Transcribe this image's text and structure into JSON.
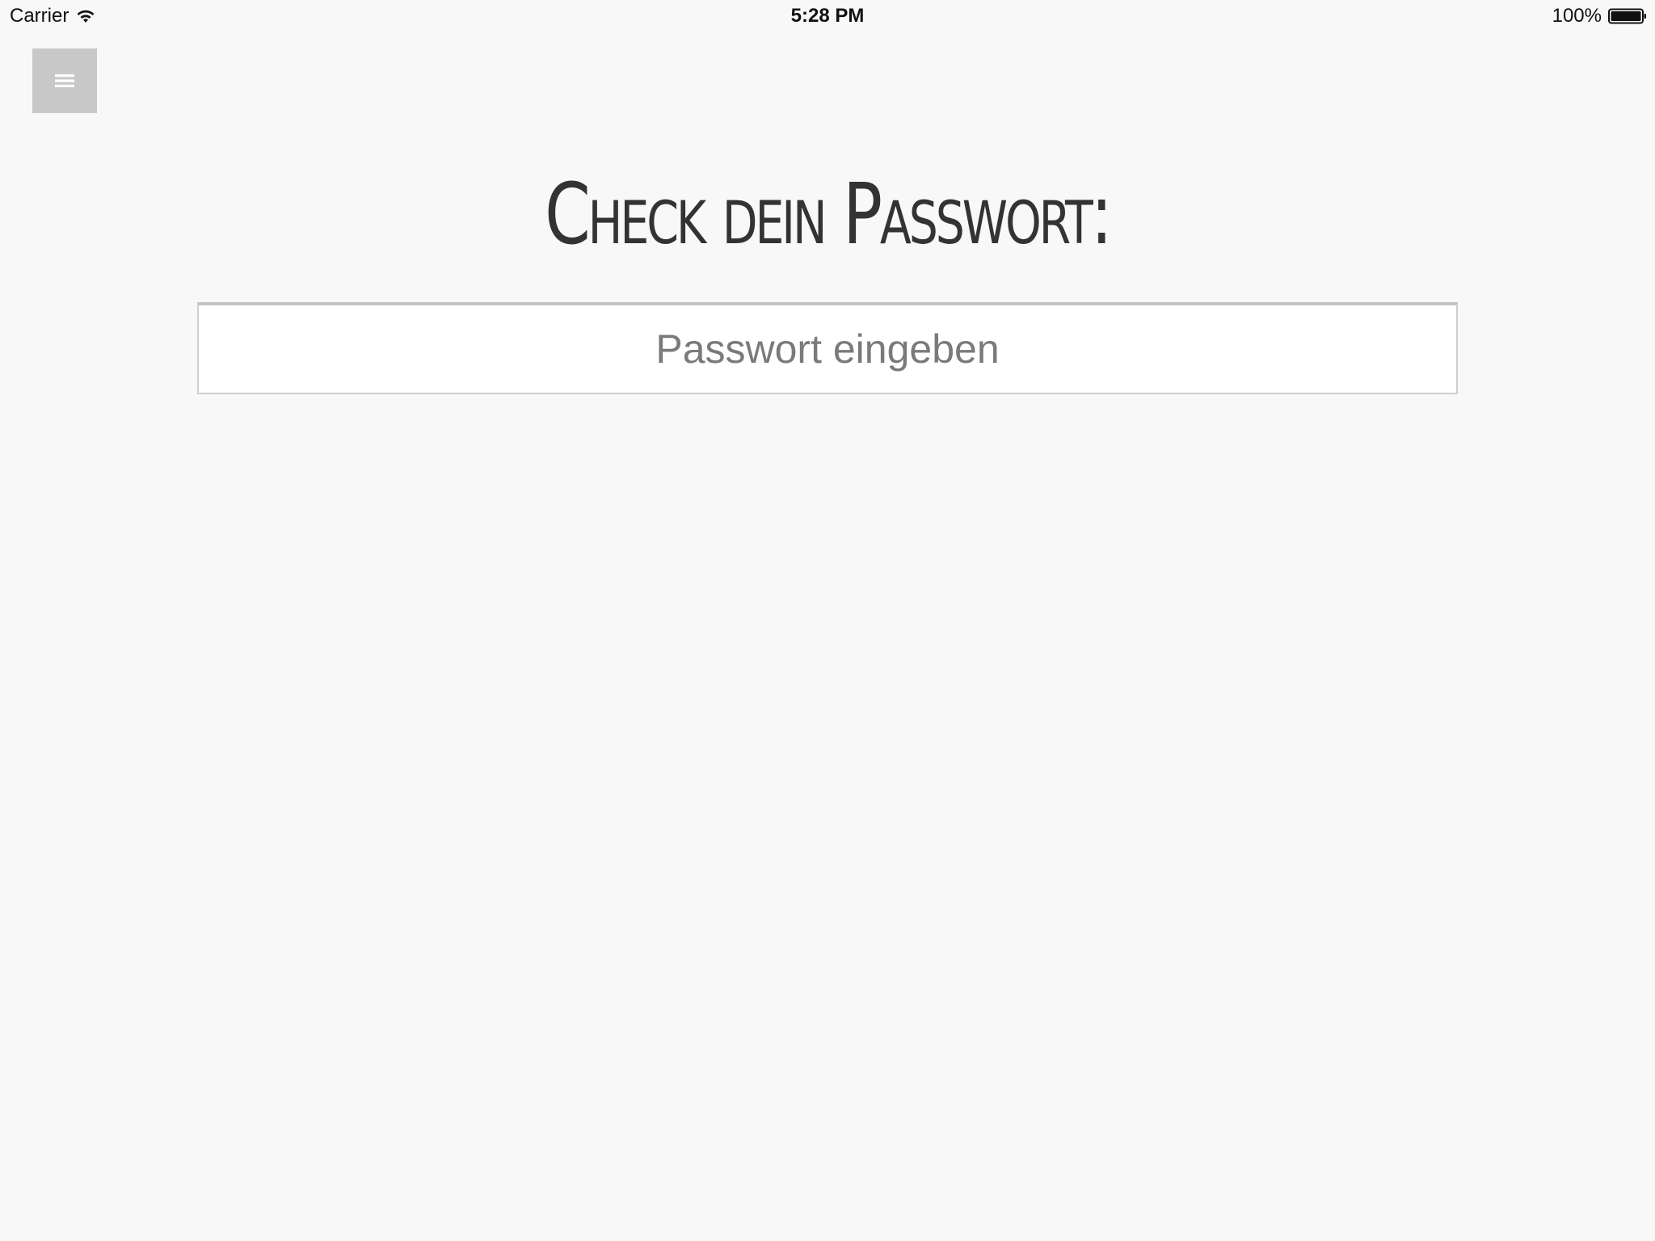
{
  "status_bar": {
    "carrier": "Carrier",
    "wifi_icon": "wifi-icon",
    "time": "5:28 PM",
    "battery_percent": "100%",
    "battery_icon": "battery-icon",
    "battery_level": 1.0
  },
  "menu": {
    "icon": "hamburger-icon",
    "button_color": "#c8c8c8"
  },
  "main": {
    "title": "Check dein Passwort:",
    "password_field": {
      "placeholder": "Passwort eingeben",
      "value": ""
    }
  },
  "colors": {
    "background": "#f8f8f8",
    "title": "#333333",
    "placeholder": "#7a7a7a",
    "field_border": "#cfcfcf"
  }
}
